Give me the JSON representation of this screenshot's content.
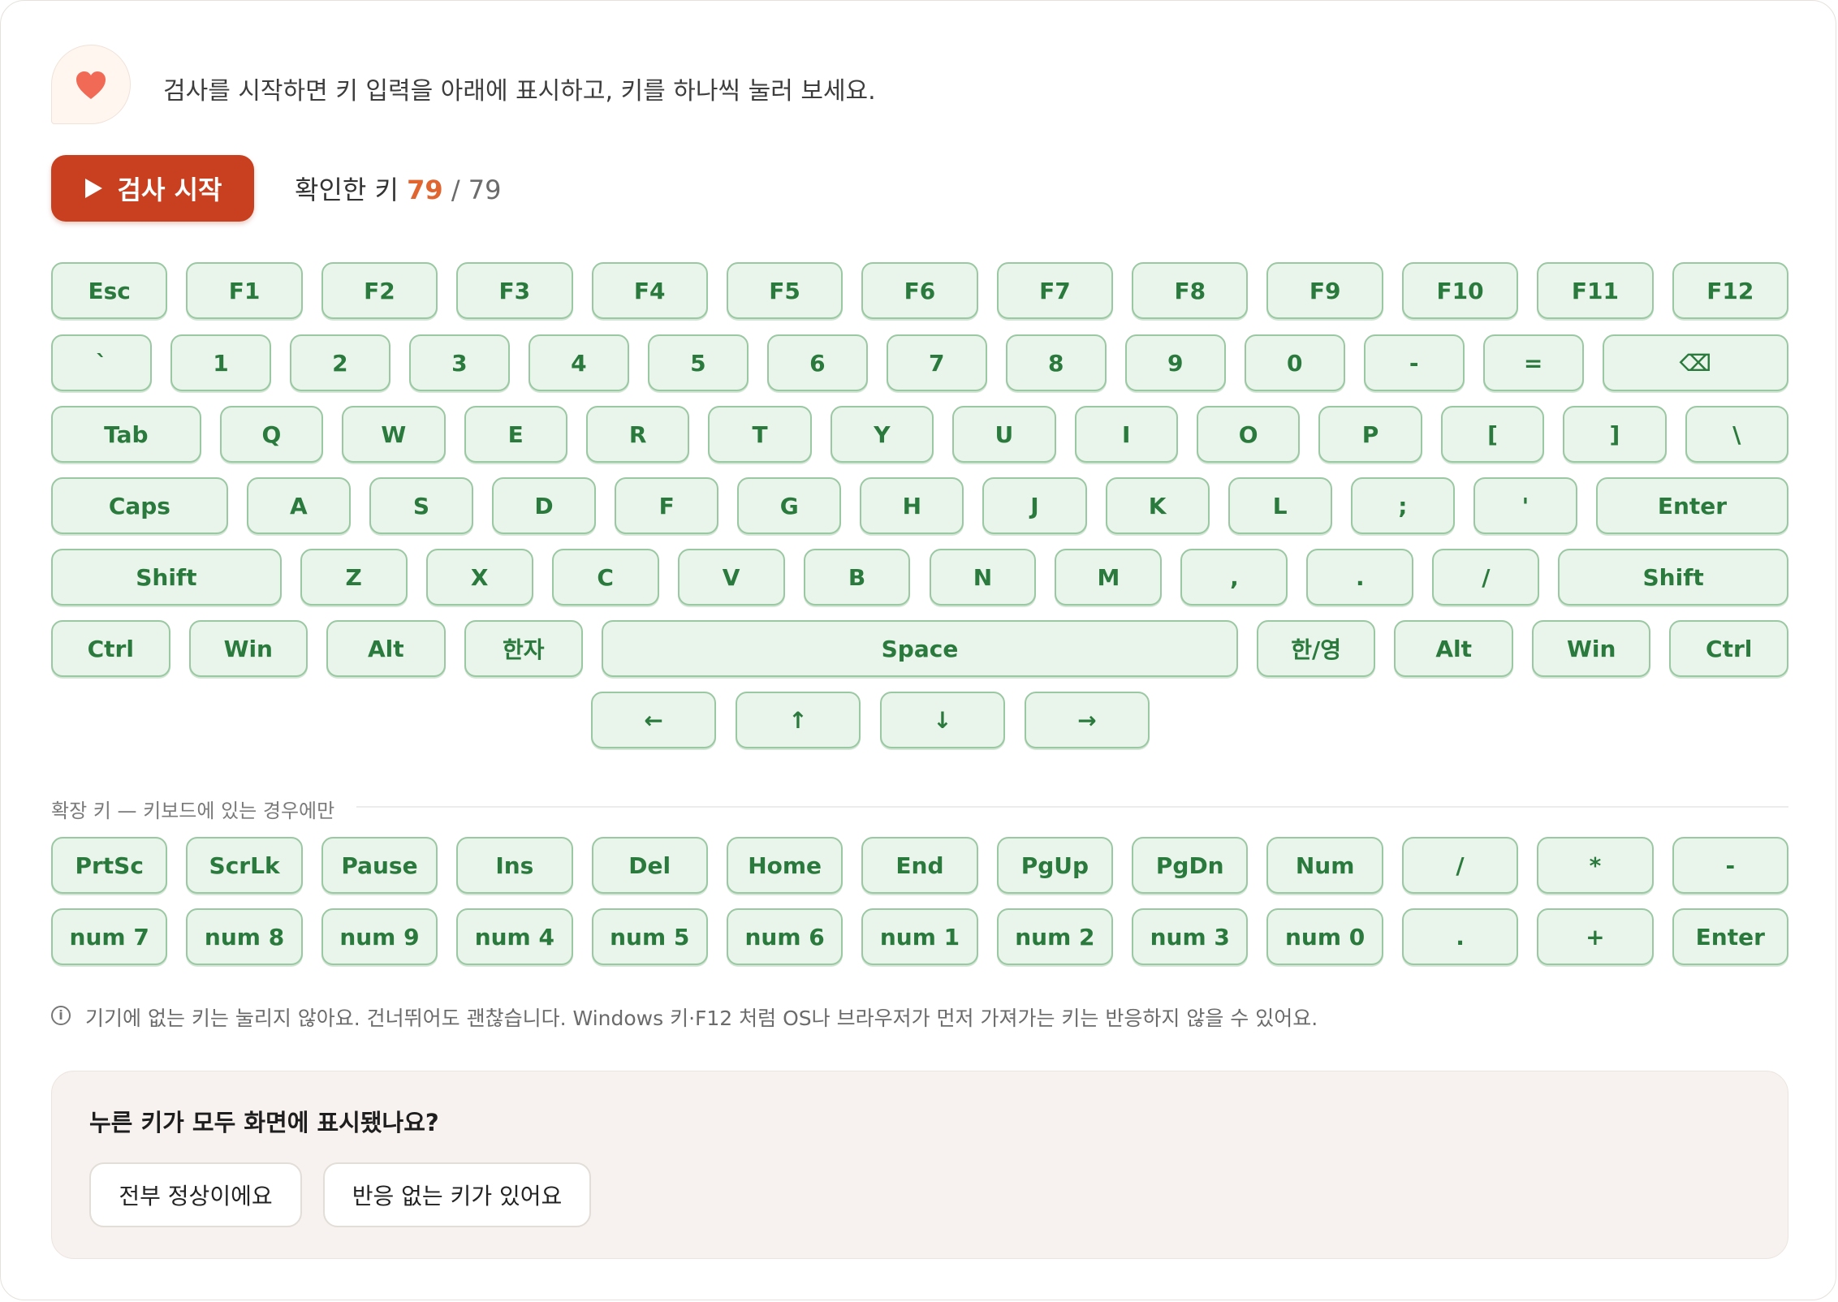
{
  "intro": {
    "text": "검사를 시작하면 키 입력을 아래에 표시하고, 키를 하나씩 눌러 보세요.",
    "icon": "heart-icon",
    "icon_color": "#f06a55"
  },
  "controls": {
    "start_label": "검사 시작",
    "count_label": "확인한 키",
    "checked": "79",
    "separator": "/",
    "total": "79",
    "accent": "#c8401f"
  },
  "keyboard": {
    "rows": [
      [
        "Esc",
        "F1",
        "F2",
        "F3",
        "F4",
        "F5",
        "F6",
        "F7",
        "F8",
        "F9",
        "F10",
        "F11",
        "F12"
      ],
      [
        "`",
        "1",
        "2",
        "3",
        "4",
        "5",
        "6",
        "7",
        "8",
        "9",
        "0",
        "-",
        "=",
        "⌫"
      ],
      [
        "Tab",
        "Q",
        "W",
        "E",
        "R",
        "T",
        "Y",
        "U",
        "I",
        "O",
        "P",
        "[",
        "]",
        "\\"
      ],
      [
        "Caps",
        "A",
        "S",
        "D",
        "F",
        "G",
        "H",
        "J",
        "K",
        "L",
        ";",
        "'",
        "Enter"
      ],
      [
        "Shift",
        "Z",
        "X",
        "C",
        "V",
        "B",
        "N",
        "M",
        ",",
        ".",
        "/",
        "Shift"
      ],
      [
        "Ctrl",
        "Win",
        "Alt",
        "한자",
        "Space",
        "한/영",
        "Alt",
        "Win",
        "Ctrl"
      ],
      [
        "←",
        "↑",
        "↓",
        "→"
      ]
    ]
  },
  "extended": {
    "label": "확장 키 — 키보드에 있는 경우에만",
    "rows": [
      [
        "PrtSc",
        "ScrLk",
        "Pause",
        "Ins",
        "Del",
        "Home",
        "End",
        "PgUp",
        "PgDn",
        "Num",
        "/",
        "*",
        "-"
      ],
      [
        "num 7",
        "num 8",
        "num 9",
        "num 4",
        "num 5",
        "num 6",
        "num 1",
        "num 2",
        "num 3",
        "num 0",
        ".",
        "+",
        "Enter"
      ]
    ]
  },
  "info": {
    "icon": "info-icon",
    "text": "기기에 없는 키는 눌리지 않아요. 건너뛰어도 괜찮습니다. Windows 키·F12 처럼 OS나 브라우저가 먼저 가져가는 키는 반응하지 않을 수 있어요."
  },
  "question": {
    "title": "누른 키가 모두 화면에 표시됐나요?",
    "all_ok": "전부 정상이에요",
    "has_dead": "반응 없는 키가 있어요"
  },
  "colors": {
    "key_bg": "#e9f4ea",
    "key_border": "#9ac8a2",
    "key_text": "#2b7a3d"
  }
}
